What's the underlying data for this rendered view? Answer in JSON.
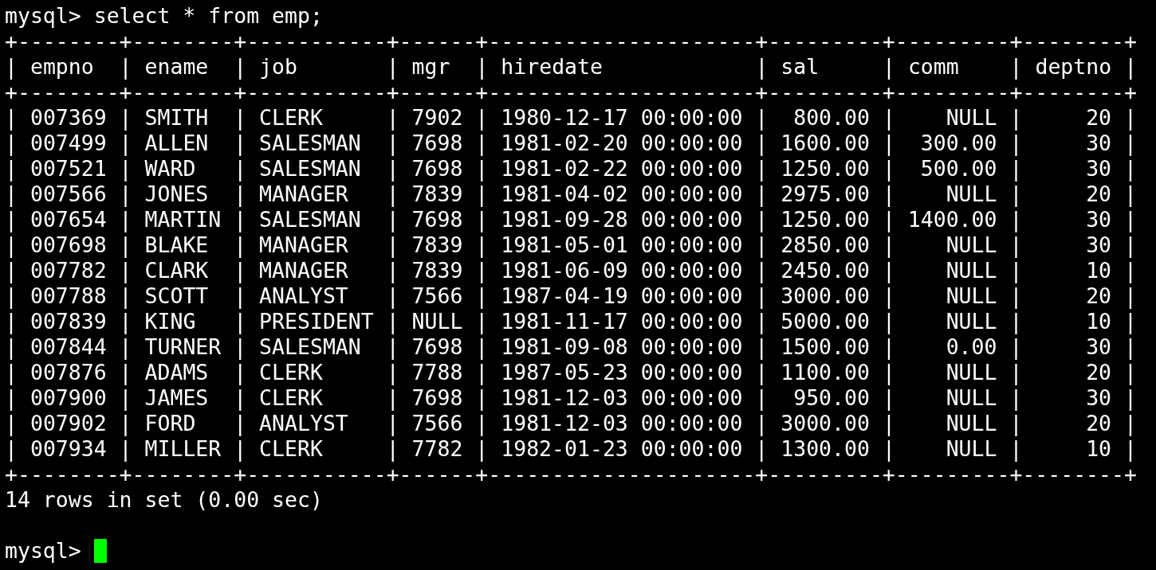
{
  "command_line": {
    "prompt": "mysql>",
    "command": "select * from emp;"
  },
  "table": {
    "separator": "|",
    "border_top": "+--------+--------+-----------+------+---------------------+---------+---------+--------+",
    "border_header": "+--------+--------+-----------+------+---------------------+---------+---------+--------+",
    "border_bottom": "+--------+--------+-----------+------+---------------------+---------+---------+--------+",
    "columns": [
      {
        "label": "empno",
        "kind": "text"
      },
      {
        "label": "ename",
        "kind": "text"
      },
      {
        "label": "job",
        "kind": "text"
      },
      {
        "label": "mgr",
        "kind": "text"
      },
      {
        "label": "hiredate",
        "kind": "text"
      },
      {
        "label": "sal",
        "kind": "number"
      },
      {
        "label": "comm",
        "kind": "number"
      },
      {
        "label": "deptno",
        "kind": "number"
      }
    ],
    "rows": [
      [
        "007369",
        "SMITH",
        "CLERK",
        "7902",
        "1980-12-17 00:00:00",
        "800.00",
        "NULL",
        "20"
      ],
      [
        "007499",
        "ALLEN",
        "SALESMAN",
        "7698",
        "1981-02-20 00:00:00",
        "1600.00",
        "300.00",
        "30"
      ],
      [
        "007521",
        "WARD",
        "SALESMAN",
        "7698",
        "1981-02-22 00:00:00",
        "1250.00",
        "500.00",
        "30"
      ],
      [
        "007566",
        "JONES",
        "MANAGER",
        "7839",
        "1981-04-02 00:00:00",
        "2975.00",
        "NULL",
        "20"
      ],
      [
        "007654",
        "MARTIN",
        "SALESMAN",
        "7698",
        "1981-09-28 00:00:00",
        "1250.00",
        "1400.00",
        "30"
      ],
      [
        "007698",
        "BLAKE",
        "MANAGER",
        "7839",
        "1981-05-01 00:00:00",
        "2850.00",
        "NULL",
        "30"
      ],
      [
        "007782",
        "CLARK",
        "MANAGER",
        "7839",
        "1981-06-09 00:00:00",
        "2450.00",
        "NULL",
        "10"
      ],
      [
        "007788",
        "SCOTT",
        "ANALYST",
        "7566",
        "1987-04-19 00:00:00",
        "3000.00",
        "NULL",
        "20"
      ],
      [
        "007839",
        "KING",
        "PRESIDENT",
        "NULL",
        "1981-11-17 00:00:00",
        "5000.00",
        "NULL",
        "10"
      ],
      [
        "007844",
        "TURNER",
        "SALESMAN",
        "7698",
        "1981-09-08 00:00:00",
        "1500.00",
        "0.00",
        "30"
      ],
      [
        "007876",
        "ADAMS",
        "CLERK",
        "7788",
        "1987-05-23 00:00:00",
        "1100.00",
        "NULL",
        "20"
      ],
      [
        "007900",
        "JAMES",
        "CLERK",
        "7698",
        "1981-12-03 00:00:00",
        "950.00",
        "NULL",
        "30"
      ],
      [
        "007902",
        "FORD",
        "ANALYST",
        "7566",
        "1981-12-03 00:00:00",
        "3000.00",
        "NULL",
        "20"
      ],
      [
        "007934",
        "MILLER",
        "CLERK",
        "7782",
        "1982-01-23 00:00:00",
        "1300.00",
        "NULL",
        "10"
      ]
    ]
  },
  "result_summary": "14 rows in set (0.00 sec)",
  "input_line": {
    "prompt": "mysql>"
  }
}
